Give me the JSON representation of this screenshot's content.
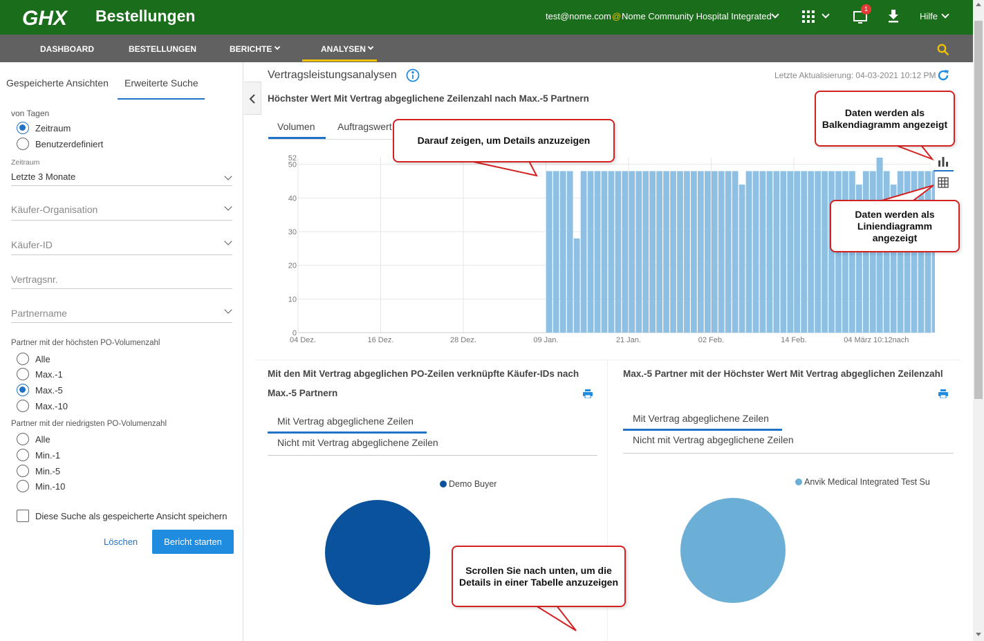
{
  "header": {
    "app_title": "Bestellungen",
    "user_email": "test@nome.com",
    "at_sign": "@",
    "org_name": "Nome Community Hospital Integrated",
    "notification_count": "1",
    "help_label": "Hilfe",
    "brand_color": "#1a6d1a"
  },
  "nav": {
    "items": [
      "DASHBOARD",
      "BESTELLUNGEN",
      "BERICHTE",
      "ANALYSEN"
    ],
    "active": "ANALYSEN"
  },
  "sidebar": {
    "tabs": [
      "Gespeicherte Ansichten",
      "Erweiterte Suche"
    ],
    "active_tab": "Erweiterte Suche",
    "days_label": "von Tagen",
    "day_options": [
      "Zeitraum",
      "Benutzerdefiniert"
    ],
    "day_selected": "Zeitraum",
    "period_label": "Zeitraum",
    "period_value": "Letzte 3 Monate",
    "buyer_org_placeholder": "Käufer-Organisation",
    "buyer_id_placeholder": "Käufer-ID",
    "contract_no_placeholder": "Vertragsnr.",
    "partner_name_placeholder": "Partnername",
    "highest_label": "Partner mit der höchsten PO-Volumenzahl",
    "highest_options": [
      "Alle",
      "Max.-1",
      "Max.-5",
      "Max.-10"
    ],
    "highest_selected": "Max.-5",
    "lowest_label": "Partner mit der niedrigsten PO-Volumenzahl",
    "lowest_options": [
      "Alle",
      "Min.-1",
      "Min.-5",
      "Min.-10"
    ],
    "save_view_label": "Diese Suche als gespeicherte Ansicht speichern",
    "clear_label": "Löschen",
    "run_label": "Bericht starten"
  },
  "main": {
    "title": "Vertragsleistungsanalysen",
    "last_update": "Letzte Aktualisierung: 04-03-2021 10:12 PM",
    "chart_title": "Höchster Wert Mit Vertrag abgeglichene Zeilenzahl nach Max.-5 Partnern",
    "chart_tabs": [
      "Volumen",
      "Auftragswert"
    ],
    "panel_left": {
      "title": "Mit den Mit Vertrag abgeglichen PO-Zeilen verknüpfte Käufer-IDs nach Max.-5 Partnern",
      "tabs": [
        "Mit Vertrag abgeglichene Zeilen",
        "Nicht mit Vertrag abgeglichene Zeilen"
      ],
      "legend": "Demo Buyer",
      "color": "#0a529c"
    },
    "panel_right": {
      "title": "Max.-5 Partner mit der Höchster Wert Mit Vertrag abgeglichen Zeilenzahl",
      "tabs": [
        "Mit Vertrag abgeglichene Zeilen",
        "Nicht mit Vertrag abgeglichene Zeilen"
      ],
      "legend": "Anvik Medical Integrated Test Su",
      "color": "#6baed6"
    }
  },
  "callouts": {
    "hover": "Darauf zeigen, um Details anzuzeigen",
    "bar": "Daten werden als Balkendiagramm angezeigt",
    "line": "Daten werden als Liniendiagramm angezeigt",
    "scroll": "Scrollen Sie nach unten, um die Details in einer Tabelle anzuzeigen"
  },
  "chart_data": {
    "type": "bar",
    "x_tick_labels": [
      "04 Dez.",
      "16 Dez.",
      "28 Dez.",
      "09 Jan.",
      "21 Jan.",
      "02 Feb.",
      "14 Feb.",
      "04 März 10:12nach"
    ],
    "y_ticks": [
      0,
      10,
      20,
      30,
      40,
      50,
      52
    ],
    "ylim": [
      0,
      52
    ],
    "bar_color": "#8dc0e3",
    "data_start_index": 36,
    "total_slots": 92,
    "values": [
      48,
      48,
      48,
      48,
      28,
      48,
      48,
      48,
      48,
      48,
      48,
      48,
      48,
      48,
      48,
      48,
      48,
      48,
      48,
      48,
      48,
      48,
      48,
      48,
      48,
      48,
      48,
      48,
      44,
      48,
      48,
      48,
      48,
      48,
      48,
      48,
      48,
      48,
      48,
      48,
      48,
      48,
      48,
      48,
      48,
      44,
      48,
      48,
      52,
      48,
      44,
      48,
      48,
      48,
      48,
      48,
      48,
      48,
      48,
      48,
      48,
      48,
      48,
      44,
      48,
      48,
      48,
      48,
      48,
      48,
      44
    ]
  }
}
